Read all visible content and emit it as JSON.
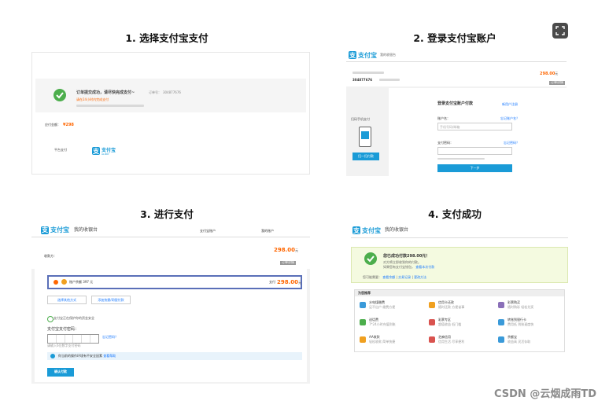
{
  "steps": [
    {
      "title": "1. 选择支付宝支付"
    },
    {
      "title": "2. 登录支付宝账户"
    },
    {
      "title": "3. 进行支付"
    },
    {
      "title": "4. 支付成功"
    }
  ],
  "panel1": {
    "success_text": "订单提交成功，请尽快完成支付~",
    "order_label": "订单号：",
    "order_no": "304877676",
    "amount_hint": "请在24小时内完成支付",
    "pay_amount_label": "应付金额：",
    "pay_amount": "¥298",
    "platform_label": "平台支付",
    "alipay_brand": "支付宝",
    "alipay_sub": "ALIPAY"
  },
  "panel2": {
    "brand": "支付宝",
    "cashier": "我的收银台",
    "order_no": "304877676",
    "amount": "298.00",
    "amount_unit": "元",
    "detail_btn": "订单详情",
    "scan_title": "扫码手机支付",
    "scan_btn": "扫一扫付款",
    "login_title": "登录支付宝账户付款",
    "register_link": "新用户注册",
    "account_label": "账户名：",
    "account_placeholder": "手机号码/邮箱",
    "forgot_account": "忘记账户名？",
    "password_label": "支付密码：",
    "forgot_password": "忘记密码？",
    "next_btn": "下一步"
  },
  "panel3": {
    "brand": "支付宝",
    "cashier": "我的收银台",
    "account_label": "支付宝账户",
    "tab_right": "我的账户",
    "amount": "298.00",
    "amount_unit": "元",
    "order_btn": "订单详情",
    "merchant_label": "收款方：",
    "balance_label": "账户余额",
    "balance_value": "397 元",
    "pay_label": "支付",
    "pay_amount": "298.00",
    "pay_unit": "元",
    "other_method_btn": "选择其他方式",
    "add_card_btn": "添加快捷/网银付款",
    "security_tip": "支付宝正在保护你的资金安全",
    "pwd_title": "支付宝支付密码：",
    "forgot_pwd": "忘记密码？",
    "pwd_hint": "请输入6位数字支付密码",
    "notice_text": "你当前的操作环境有不安全因素",
    "notice_link": "查看帮助",
    "confirm_btn": "确认付款"
  },
  "panel4": {
    "brand": "支付宝",
    "cashier": "我的收银台",
    "success_title": "您已成功付款298.00元！",
    "success_sub1": "对方将立即收到你的付款。",
    "success_sub2": "如果您有支付宝钱包，",
    "success_link": "查看本次付款",
    "links_label": "您可能需要：",
    "links": [
      "查看余额",
      "交易记录",
      "更改方法"
    ],
    "rec_title": "为您推荐",
    "rec_items": [
      {
        "name": "水电煤缴费",
        "desc": "足不出户 缴费方便"
      },
      {
        "name": "信用卡还款",
        "desc": "随时还款 方便省事"
      },
      {
        "name": "彩票购买",
        "desc": "随时购彩 轻松兑奖"
      },
      {
        "name": "送话费",
        "desc": "7*24小时充值到账"
      },
      {
        "name": "彩票专区",
        "desc": "超值收益 低门槛"
      },
      {
        "name": "转账到银行卡",
        "desc": "费用低 到账速度快"
      },
      {
        "name": "AA收款",
        "desc": "轻松收款 简单快捷"
      },
      {
        "name": "芝麻信用",
        "desc": "信用生活 尽享便利"
      },
      {
        "name": "余额宝",
        "desc": "收益高 灵活存取"
      }
    ]
  },
  "watermark": "CSDN @云烟成雨TD"
}
